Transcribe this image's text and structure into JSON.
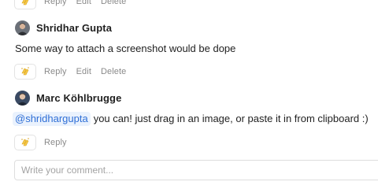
{
  "thread": {
    "top_actions": {
      "reply_label": "Reply",
      "edit_label": "Edit",
      "delete_label": "Delete"
    },
    "comments": [
      {
        "author": "Shridhar Gupta",
        "text": "Some way to attach a screenshot would be dope",
        "actions": {
          "reply_label": "Reply",
          "edit_label": "Edit",
          "delete_label": "Delete"
        }
      },
      {
        "author": "Marc Köhlbrugge",
        "mention": "@shridhargupta",
        "text": "you can! just drag in an image, or paste it in from clipboard :)",
        "actions": {
          "reply_label": "Reply"
        }
      }
    ]
  },
  "composer": {
    "placeholder": "Write your comment..."
  },
  "icons": {
    "reaction": "clapping-hands-icon",
    "avatar": "user-avatar"
  },
  "colors": {
    "mention_text": "#2f6fd6",
    "mention_bg": "#eaf2fd",
    "muted_text": "#8a8a8a",
    "emoji_yellow": "#f7c948"
  }
}
